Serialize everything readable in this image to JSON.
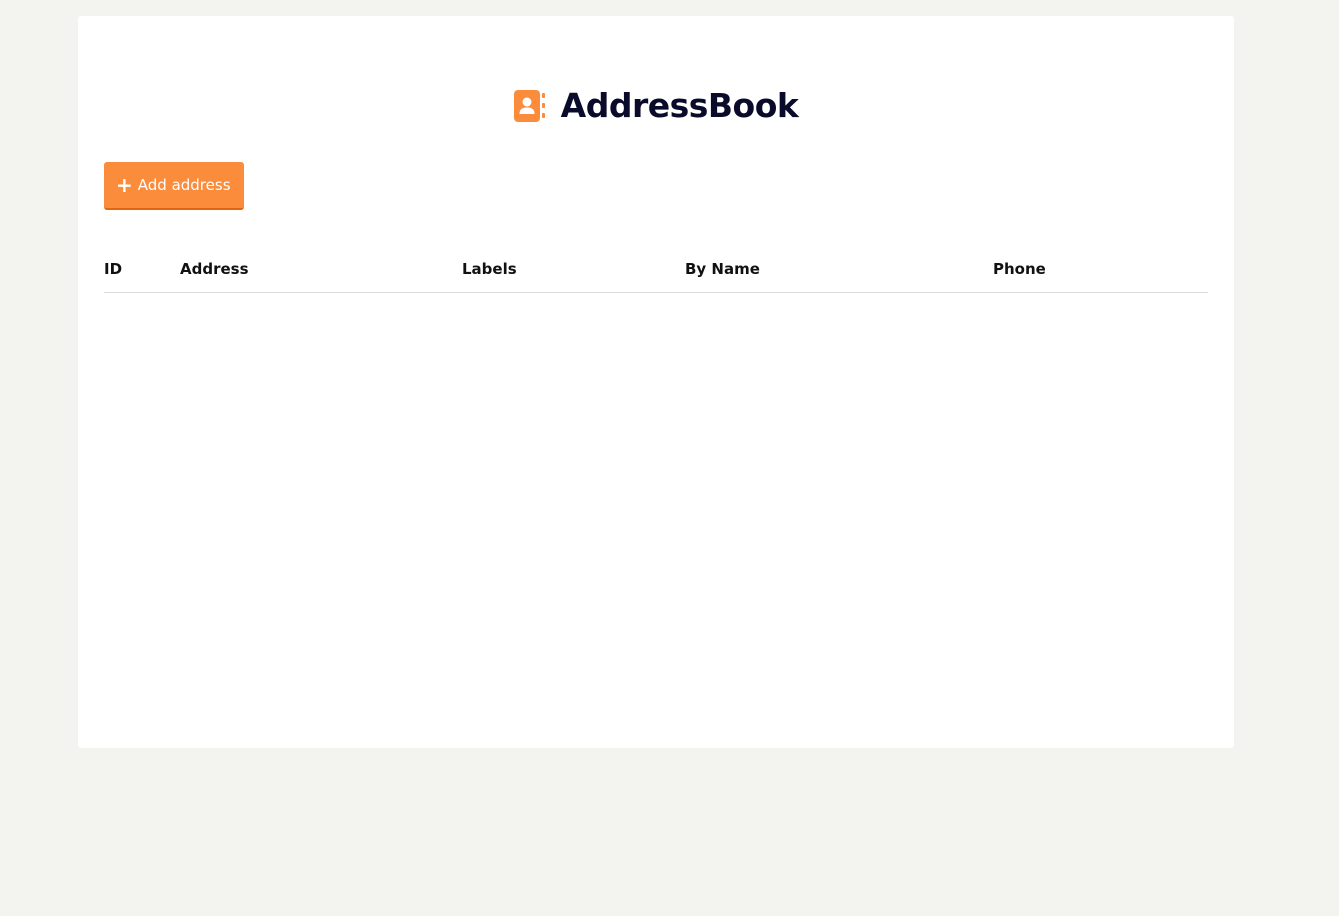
{
  "app": {
    "title": "AddressBook",
    "icon": "address-book-icon",
    "accent_color": "#fb8c3b"
  },
  "toolbar": {
    "add_label": "Add address",
    "add_icon": "plus-icon"
  },
  "table": {
    "columns": [
      "ID",
      "Address",
      "Labels",
      "By Name",
      "Phone"
    ],
    "rows": []
  }
}
